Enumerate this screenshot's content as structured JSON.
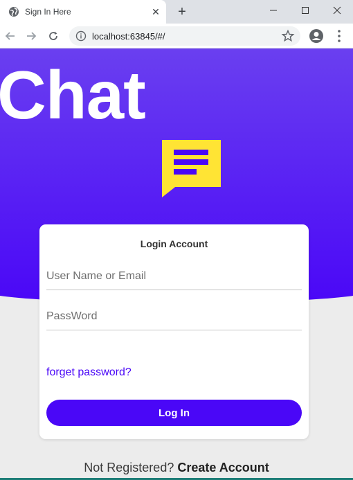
{
  "browser": {
    "tab_title": "Sign In Here",
    "tab_close": "✕",
    "new_tab": "+",
    "url": "localhost:63845/#/"
  },
  "page": {
    "hero_title": "Chat",
    "logo_icon": "chat-bubble-icon",
    "login": {
      "title": "Login Account",
      "username_placeholder": "User Name or Email",
      "password_placeholder": "PassWord",
      "forgot_label": "forget password?",
      "login_button": "Log In"
    },
    "footer": {
      "prompt": "Not Registered?",
      "create_link": "Create Account"
    }
  },
  "colors": {
    "primary": "#4a07f7",
    "gradient_top": "#6a3ff0",
    "logo_yellow": "#ffe434",
    "background": "#ececec"
  }
}
